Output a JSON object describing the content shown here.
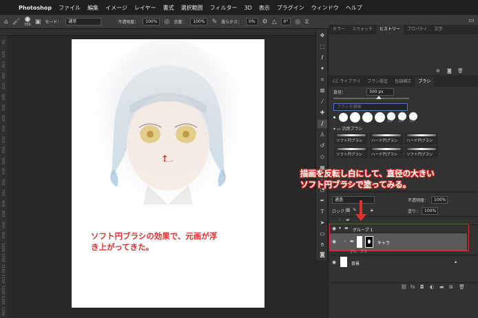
{
  "menubar": {
    "apple_icon": "apple-icon",
    "items": [
      "Photoshop",
      "ファイル",
      "編集",
      "イメージ",
      "レイヤー",
      "書式",
      "選択範囲",
      "フィルター",
      "3D",
      "表示",
      "プラグイン",
      "ウィンドウ",
      "ヘルプ"
    ]
  },
  "options": {
    "brush_size": "350",
    "mode_label": "モード：",
    "mode_value": "通常",
    "opacity_label": "不透明度：",
    "opacity_value": "100%",
    "flow_label": "流量：",
    "flow_value": "100%",
    "smoothing_label": "滑らかさ：",
    "smoothing_value": "0%",
    "angle_value": "0°"
  },
  "ruler": {
    "left_ticks": [
      "50",
      "100",
      "150",
      "200",
      "250",
      "300",
      "350",
      "400",
      "450",
      "500",
      "550",
      "600",
      "650",
      "700",
      "750",
      "800",
      "850",
      "900",
      "950",
      "1000",
      "1050",
      "1100",
      "1150",
      "1200",
      "1250",
      "1300"
    ]
  },
  "panels": {
    "top_tabs": [
      "カラー",
      "スウォッチ",
      "ヒストリー",
      "プロパティ",
      "文字"
    ],
    "top_active_tab": "ヒストリー",
    "brush_tabs": [
      "CC ライブラリ",
      "ブラシ設定",
      "色調補正",
      "ブラシ"
    ],
    "brush_active_tab": "ブラシ",
    "size_label": "直径：",
    "size_value": "300 px",
    "search_placeholder": "ブラシを検索",
    "preset_sizes": [
      "175",
      "175",
      "175"
    ],
    "group_name": "汎用ブラシ",
    "brushes": [
      "ソフト円ブラシ",
      "ハード円ブラシ",
      "ハード円ブラシ",
      "ソフト円ブラシ",
      "ハード円ブラシ",
      "ソフト円ブラシ"
    ]
  },
  "layers": {
    "blend_mode": "通過",
    "opacity_label": "不透明度：",
    "opacity_value": "100%",
    "lock_label": "ロック：",
    "fill_label": "塗り：",
    "fill_value": "100%",
    "rows": [
      {
        "name": "グループ 1",
        "kind": "group"
      },
      {
        "name": "キャラ",
        "kind": "layer-mask"
      },
      {
        "name": "グループ 2",
        "kind": "group"
      },
      {
        "name": "背景",
        "kind": "background"
      }
    ]
  },
  "annotations": {
    "canvas_arrow": "↑",
    "canvas_note_line1": "ソフト円ブラシの効果で、元画が浮",
    "canvas_note_line2": "き上がってきた。",
    "callout_line1": "描画を反転し白にして、直径の大きい",
    "callout_line2": "ソフト円ブラシで塗ってみる。",
    "accent_color": "#e2302a"
  }
}
